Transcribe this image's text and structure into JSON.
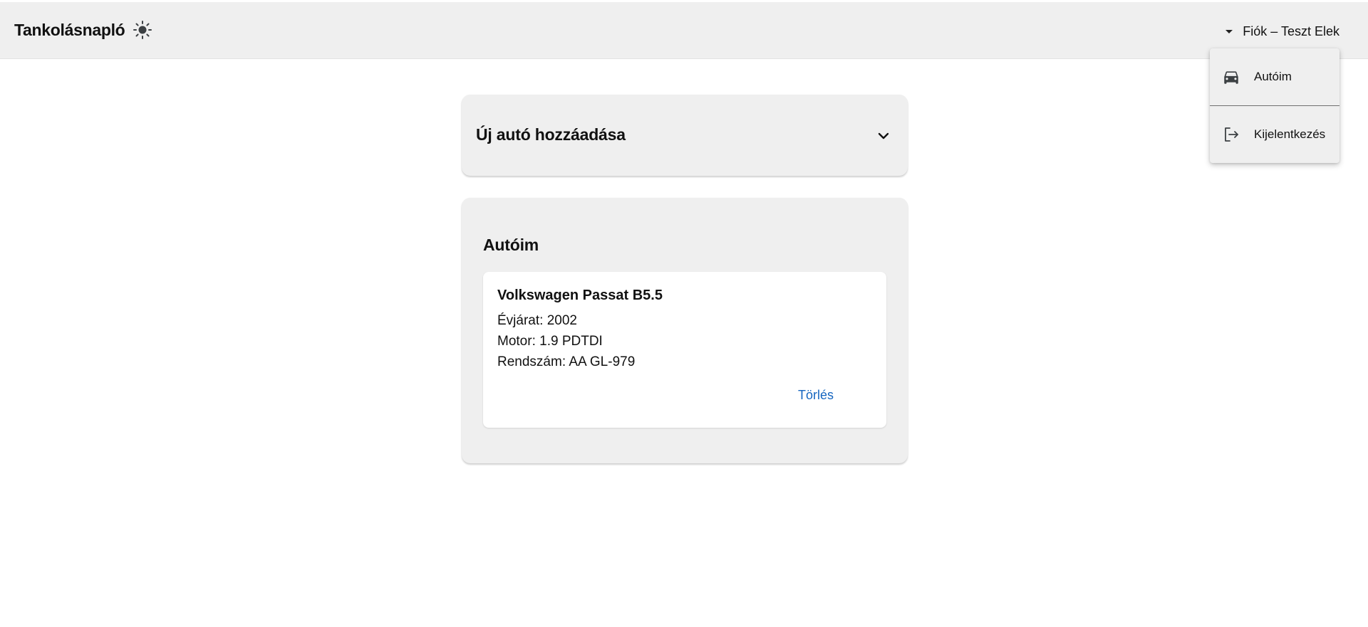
{
  "app": {
    "title": "Tankolásnapló",
    "theme_icon": "sun-icon"
  },
  "account": {
    "label": "Fiók – Teszt Elek",
    "menu": [
      {
        "label": "Autóim",
        "icon": "car-icon"
      },
      {
        "label": "Kijelentkezés",
        "icon": "logout-icon"
      }
    ]
  },
  "add_car": {
    "title": "Új autó hozzáadása",
    "expand_icon": "chevron-down-icon"
  },
  "my_cars": {
    "title": "Autóim",
    "cars": [
      {
        "name": "Volkswagen Passat B5.5",
        "year_line": "Évjárat: 2002",
        "engine_line": "Motor: 1.9 PDTDI",
        "plate_line": "Rendszám: AA GL-979",
        "delete_label": "Törlés"
      }
    ]
  },
  "colors": {
    "surface": "#efefef",
    "link": "#1565c0",
    "icon": "#3c4043"
  }
}
